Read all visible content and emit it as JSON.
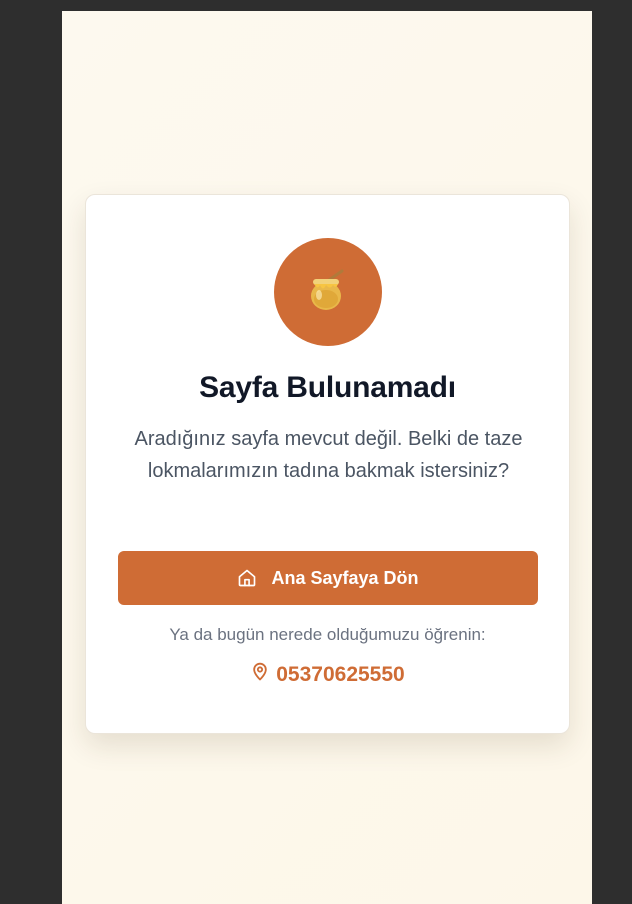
{
  "card": {
    "icon": "honey-pot-icon",
    "title": "Sayfa Bulunamadı",
    "description": "Aradığınız sayfa mevcut değil. Belki de taze lokmalarımızın tadına bakmak istersiniz?",
    "home_button": {
      "label": "Ana Sayfaya Dön",
      "icon": "home-icon"
    },
    "alt_text": "Ya da bugün nerede olduğumuzu öğrenin:",
    "phone": {
      "number": "05370625550",
      "icon": "map-pin-icon"
    }
  },
  "colors": {
    "accent": "#cf6c35",
    "title": "#111827",
    "body_text": "#4b5563",
    "muted_text": "#6b7280",
    "page_background": "#fdf9ef",
    "frame": "#2e2e2e"
  }
}
